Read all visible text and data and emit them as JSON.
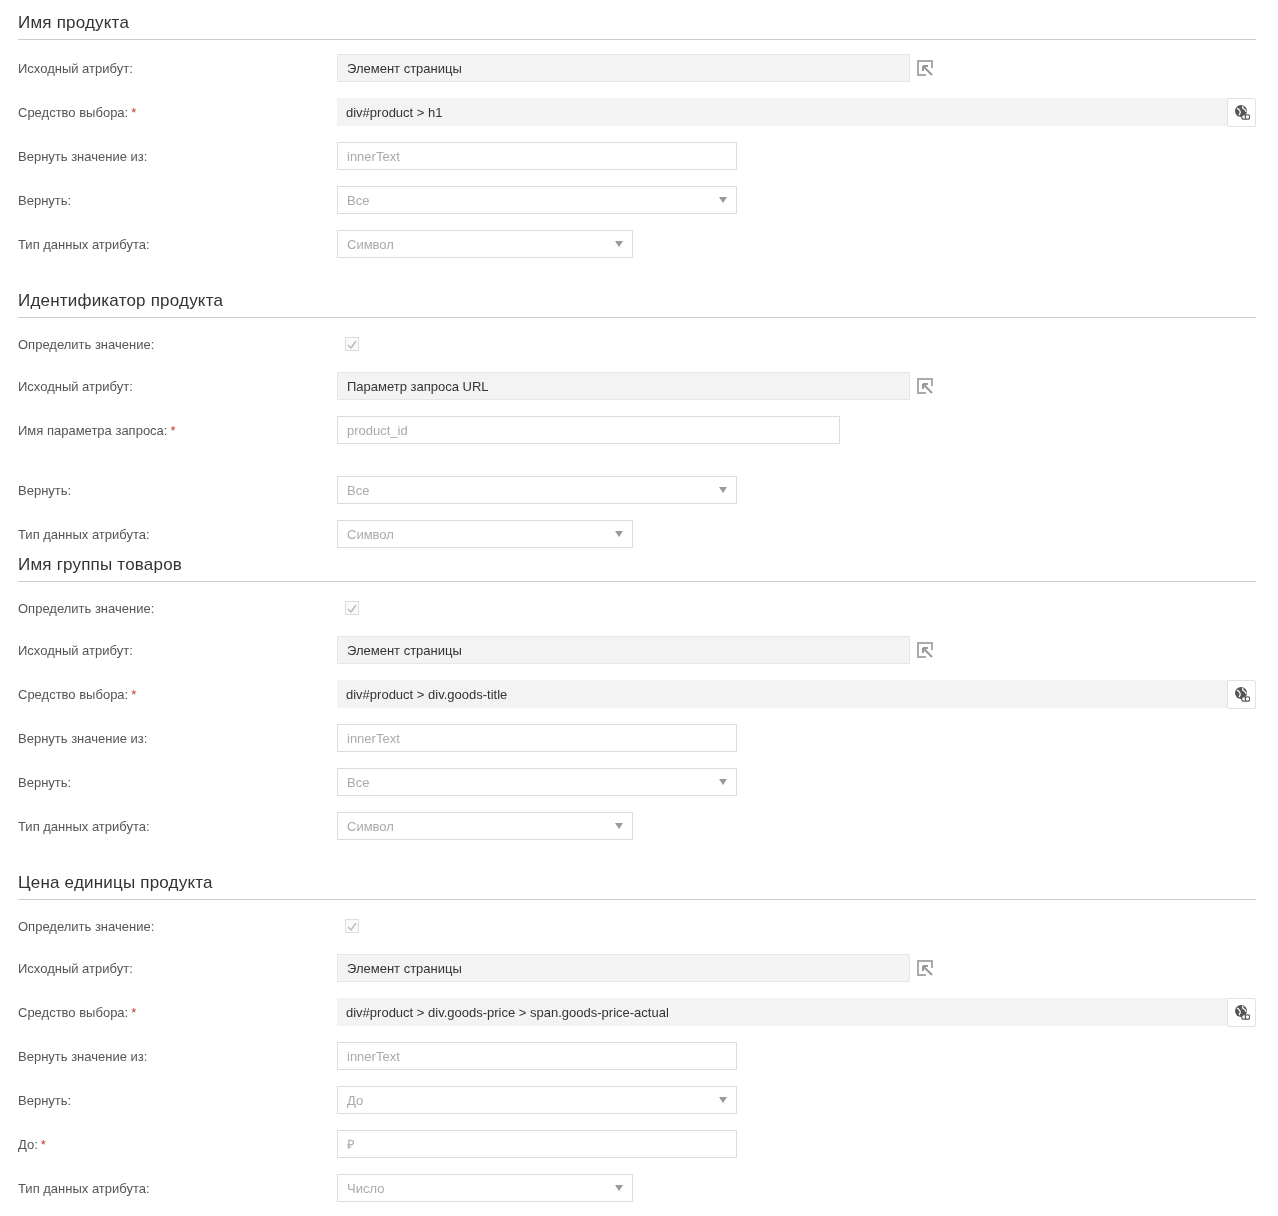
{
  "sections": [
    {
      "title": "Имя продукта",
      "rows": [
        {
          "kind": "source",
          "label": "Исходный атрибут:",
          "value": "Элемент страницы"
        },
        {
          "kind": "selector",
          "label": "Средство выбора:",
          "required_mark": "*",
          "value": "div#product > h1"
        },
        {
          "kind": "input",
          "label": "Вернуть значение из:",
          "placeholder": "innerText"
        },
        {
          "kind": "select",
          "label": "Вернуть:",
          "value": "Все"
        },
        {
          "kind": "type-select",
          "label": "Тип данных атрибута:",
          "value": "Символ"
        }
      ]
    },
    {
      "title": "Идентификатор продукта",
      "cut_off": true,
      "rows": [
        {
          "kind": "checkbox",
          "label": "Определить значение:",
          "checked": true
        },
        {
          "kind": "source",
          "label": "Исходный атрибут:",
          "value": "Параметр запроса URL"
        },
        {
          "kind": "param",
          "label": "Имя параметра запроса:",
          "required_mark": "*",
          "placeholder": "product_id"
        },
        {
          "kind": "select",
          "label": "Вернуть:",
          "value": "Все"
        },
        {
          "kind": "type-select",
          "label": "Тип данных атрибута:",
          "value": "Символ"
        }
      ]
    },
    {
      "title": "Имя группы товаров",
      "rows": [
        {
          "kind": "checkbox",
          "label": "Определить значение:",
          "checked": true
        },
        {
          "kind": "source",
          "label": "Исходный атрибут:",
          "value": "Элемент страницы"
        },
        {
          "kind": "selector",
          "label": "Средство выбора:",
          "required_mark": "*",
          "value": "div#product > div.goods-title"
        },
        {
          "kind": "input",
          "label": "Вернуть значение из:",
          "placeholder": "innerText"
        },
        {
          "kind": "select",
          "label": "Вернуть:",
          "value": "Все"
        },
        {
          "kind": "type-select",
          "label": "Тип данных атрибута:",
          "value": "Символ"
        }
      ]
    },
    {
      "title": "Цена единицы продукта",
      "rows": [
        {
          "kind": "checkbox",
          "label": "Определить значение:",
          "checked": true
        },
        {
          "kind": "source",
          "label": "Исходный атрибут:",
          "value": "Элемент страницы"
        },
        {
          "kind": "selector",
          "label": "Средство выбора:",
          "required_mark": "*",
          "value": "div#product > div.goods-price > span.goods-price-actual"
        },
        {
          "kind": "input",
          "label": "Вернуть значение из:",
          "placeholder": "innerText"
        },
        {
          "kind": "select",
          "label": "Вернуть:",
          "value": "До"
        },
        {
          "kind": "input",
          "label": "До:",
          "required_mark": "*",
          "placeholder": "₽"
        },
        {
          "kind": "type-select",
          "label": "Тип данных атрибута:",
          "value": "Число"
        }
      ]
    }
  ]
}
